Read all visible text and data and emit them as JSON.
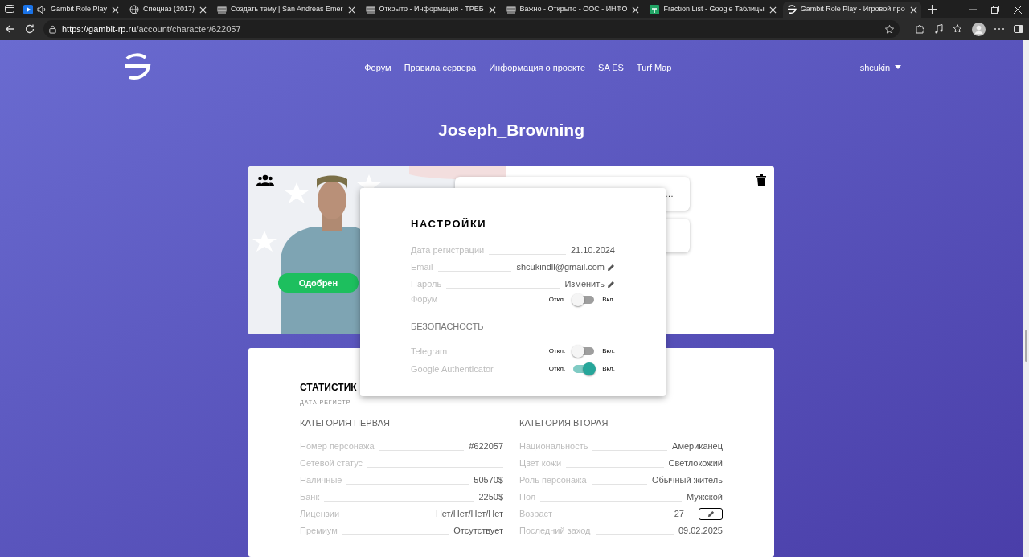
{
  "browser": {
    "tabs": [
      {
        "title": "Gambit Role Play",
        "kind": "play",
        "audio": true,
        "selected": false
      },
      {
        "title": "Спецназ (2017)",
        "kind": "globe",
        "audio": false,
        "selected": false
      },
      {
        "title": "Создать тему | San Andreas Emer",
        "kind": "forum",
        "audio": false,
        "selected": false
      },
      {
        "title": "Открыто - Информация - ТРЕБ",
        "kind": "forum",
        "audio": false,
        "selected": false
      },
      {
        "title": "Важно - Открыто - ООС - ИНФО",
        "kind": "forum",
        "audio": false,
        "selected": false
      },
      {
        "title": "Fraction List - Google Таблицы",
        "kind": "sheet",
        "audio": false,
        "selected": false
      },
      {
        "title": "Gambit Role Play - Игровой про",
        "kind": "gambit",
        "audio": false,
        "selected": true
      }
    ],
    "url_host": "https://gambit-rp.ru",
    "url_path": "/account/character/622057"
  },
  "nav": {
    "links": [
      "Форум",
      "Правила сервера",
      "Информация о проекте",
      "SA ES",
      "Turf Map"
    ],
    "user": "shcukin"
  },
  "title": "Joseph_Browning",
  "character": {
    "status": "Одобрен",
    "side_cards": [
      {
        "kind": "text",
        "text": "…"
      },
      {
        "kind": "empty"
      }
    ]
  },
  "settings": {
    "heading": "НАСТРОЙКИ",
    "rows": [
      {
        "kind": "field",
        "label": "Дата регистрации",
        "value": "21.10.2024",
        "editable": false
      },
      {
        "kind": "field",
        "label": "Email",
        "value": "shcukindll@gmail.com",
        "editable": true
      },
      {
        "kind": "field",
        "label": "Пароль",
        "value": "Изменить",
        "editable": true
      },
      {
        "kind": "toggle",
        "label": "Форум",
        "off_label": "Откл.",
        "on_label": "Вкл.",
        "on": false
      },
      {
        "kind": "section",
        "label": "БЕЗОПАСНОСТЬ"
      },
      {
        "kind": "toggle",
        "label": "Telegram",
        "off_label": "Откл.",
        "on_label": "Вкл.",
        "on": false
      },
      {
        "kind": "toggle",
        "label": "Google Authenticator",
        "off_label": "Откл.",
        "on_label": "Вкл.",
        "on": true
      }
    ]
  },
  "stats": {
    "heading": "СТАТИСТИК",
    "subtitle": "ДАТА РЕГИСТР",
    "columns": [
      {
        "heading": "КАТЕГОРИЯ ПЕРВАЯ",
        "rows": [
          {
            "label": "Номер персонажа",
            "value": "#622057",
            "editable": false
          },
          {
            "label": "Сетевой статус",
            "editable": false
          },
          {
            "label": "Наличные",
            "value": "50570$",
            "editable": false
          },
          {
            "label": "Банк",
            "value": "2250$",
            "editable": false
          },
          {
            "label": "Лицензии",
            "value": "Нет/Нет/Нет/Нет",
            "editable": false
          },
          {
            "label": "Премиум",
            "value": "Отсутствует",
            "editable": false
          }
        ]
      },
      {
        "heading": "КАТЕГОРИЯ ВТОРАЯ",
        "rows": [
          {
            "label": "Национальность",
            "value": "Американец",
            "editable": false
          },
          {
            "label": "Цвет кожи",
            "value": "Светлокожий",
            "editable": false
          },
          {
            "label": "Роль персонажа",
            "value": "Обычный житель",
            "editable": false
          },
          {
            "label": "Пол",
            "value": "Мужской",
            "editable": false
          },
          {
            "label": "Возраст",
            "value": "27",
            "editable": true
          },
          {
            "label": "Последний заход",
            "value": "09.02.2025",
            "editable": false
          }
        ]
      }
    ]
  }
}
